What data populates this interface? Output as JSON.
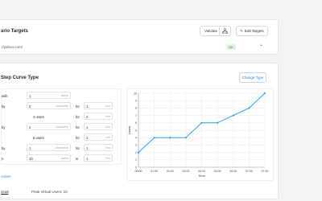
{
  "header": {
    "title": "ario Targets",
    "validate_label": "Validate",
    "edit_label": "Edit Targets",
    "url": "://yahoo.com/",
    "status_badge": "OK"
  },
  "curve": {
    "title": "Step Curve Type",
    "change_label": "Change Type",
    "rows": [
      {
        "label": "with",
        "v1": "1",
        "u1": "users"
      },
      {
        "label": "by",
        "v1": "2",
        "u1": "users/min",
        "mid": "for",
        "v2": "1",
        "u2": "min"
      },
      {
        "label": "",
        "text": "4 users",
        "mid": "for",
        "v2": "2",
        "u2": "min"
      },
      {
        "label": "by",
        "v1": "2",
        "u1": "users/min",
        "mid": "for",
        "v2": "1",
        "u2": "min"
      },
      {
        "label": "",
        "text": "6 users",
        "mid": "for",
        "v2": "1",
        "u2": "min"
      },
      {
        "label": "by",
        "v1": "1",
        "u1": "users/min",
        "mid": "for",
        "v2": "1",
        "u2": "min"
      },
      {
        "label": "n",
        "v1": "10",
        "u1": "users",
        "mid": "in",
        "v2": "1",
        "u2": "min"
      }
    ],
    "action_label": "Action",
    "bottom_left": "ctual",
    "peak_label": "Peak Virtual Users: 10"
  },
  "chart_data": {
    "type": "line",
    "x": [
      "00:00",
      "01:00",
      "02:00",
      "03:00",
      "04:00",
      "05:00",
      "06:00",
      "07:00",
      "07:30"
    ],
    "y": [
      2,
      4,
      4,
      4,
      6,
      6,
      7,
      8,
      10
    ],
    "xlabel": "Time",
    "ylabel": "Users",
    "ylim": [
      0,
      10
    ],
    "yticks": [
      0,
      1,
      2,
      3,
      4,
      5,
      6,
      7,
      8,
      9,
      10
    ],
    "line_color": "#2aa4e0",
    "grid": true
  },
  "colors": {
    "accent": "#1e7fd0",
    "line": "#2aa4e0"
  }
}
